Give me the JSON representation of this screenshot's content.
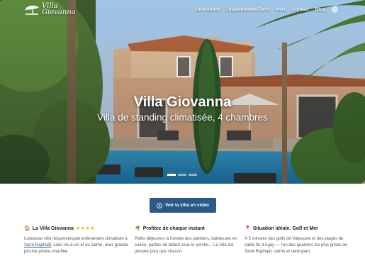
{
  "header": {
    "logo_line1": "Villa",
    "logo_line2": "Giovanna",
    "nav": [
      "Description",
      "Disponibilités/Tarifs",
      "Avis",
      "Contact",
      "Blog"
    ]
  },
  "hero": {
    "title": "Villa Giovanna",
    "subtitle": "Villa de standing climatisée, 4 chambres",
    "slides": 3,
    "active_slide": 1
  },
  "cta": {
    "label": "Voir la villa en vidéo"
  },
  "features": [
    {
      "icon": "house-icon",
      "glyph": "🏠",
      "title": "La Villa Giovanna",
      "stars": "★★★★",
      "text_before_link": "Luxueuse villa néoprovençale entièrement climatisée à ",
      "link": "Saint-Raphaël",
      "text_after_link": ", sans vis-à-vis et au calme, avec grande piscine privée chauffée."
    },
    {
      "icon": "palm-tree-icon",
      "glyph": "🌴",
      "title": "Profitez de chaque instant",
      "text": "Petits déjeuners à l'ombre des palmiers, barbecues en soirée, parties de billard sous le porche... La villa est pensée pour que chacun"
    },
    {
      "icon": "pin-icon",
      "glyph": "📍",
      "title": "Situation idéale. Golf et Mer",
      "text": "À 5 minutes des golfs de Valescure et des plages de sable fin d'Agay — l'un des quartiers les plus prisés de Saint-Raphaël, calme et verdoyant."
    }
  ]
}
